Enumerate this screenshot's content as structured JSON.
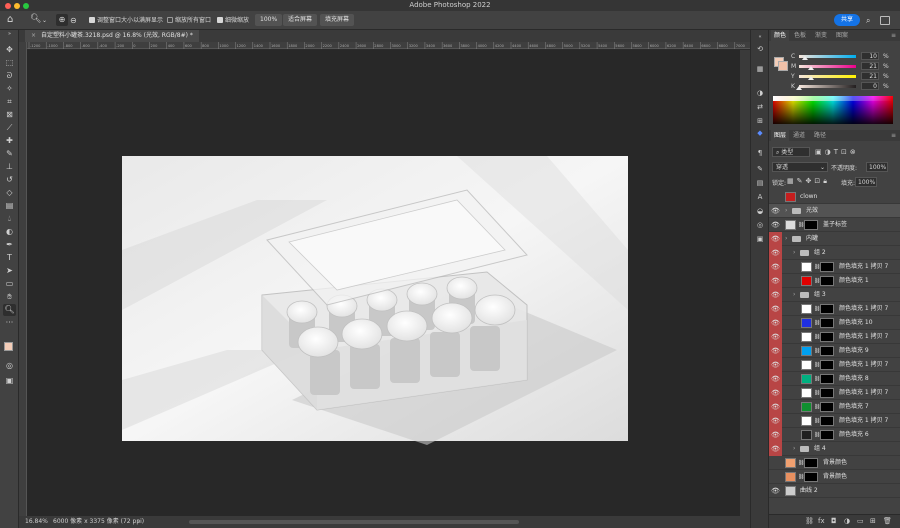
{
  "app": {
    "title": "Adobe Photoshop 2022"
  },
  "options_bar": {
    "resize_windows": "调整窗口大小以满屏显示",
    "zoom_all": "缩放所有窗口",
    "scrubby_zoom": "细微缩放",
    "zoom_value": "100%",
    "fit_screen": "适合屏幕",
    "fill_screen": "填充屏幕",
    "share": "共享"
  },
  "document": {
    "tab": "自定塑料小罐茶.3218.psd @ 16.8% (光效, RGB/8#) *",
    "status_zoom": "16.84%",
    "status_info": "6000 像素 x 3375 像素 (72 ppi)"
  },
  "ruler": {
    "top_ticks": [
      "-1200",
      "-1000",
      "-800",
      "-600",
      "-400",
      "-200",
      "0",
      "200",
      "400",
      "600",
      "800",
      "1000",
      "1200",
      "1400",
      "1600",
      "1800",
      "2000",
      "2200",
      "2400",
      "2600",
      "2800",
      "3000",
      "3200",
      "3400",
      "3600",
      "3800",
      "4000",
      "4200",
      "4400",
      "4600",
      "4800",
      "5000",
      "5200",
      "5400",
      "5600",
      "5800",
      "6000",
      "6200",
      "6400",
      "6600",
      "6800",
      "7000"
    ]
  },
  "color_panel": {
    "tabs": [
      "颜色",
      "色板",
      "渐变",
      "图案"
    ],
    "sliders": [
      {
        "label": "C",
        "value": "10",
        "color": "#00aeef"
      },
      {
        "label": "M",
        "value": "21",
        "color": "#ec008c"
      },
      {
        "label": "Y",
        "value": "21",
        "color": "#fff200"
      },
      {
        "label": "K",
        "value": "0",
        "color": "#231f20"
      }
    ],
    "pct": "%",
    "fg_color": "#f4cdb8",
    "bg_color": "#f0c0a8"
  },
  "layers_panel": {
    "tabs": [
      "图层",
      "通道",
      "路径"
    ],
    "filter": "类型",
    "blend": "穿透",
    "opacity_label": "不透明度:",
    "opacity": "100%",
    "lock_label": "锁定:",
    "fill_label": "填充:",
    "fill": "100%",
    "layers": [
      {
        "name": "clown",
        "indent": 0,
        "kind": "layer",
        "eye": false,
        "thumb": "#c51e1e",
        "mask": false,
        "swatch": "",
        "red": false
      },
      {
        "name": "光效",
        "indent": 0,
        "kind": "group",
        "eye": true,
        "thumb": "",
        "mask": false,
        "swatch": "",
        "red": false,
        "selected": true
      },
      {
        "name": "盖子标签",
        "indent": 0,
        "kind": "layer",
        "eye": true,
        "thumb": "#dcdcdc",
        "mask": true,
        "swatch": "",
        "red": false
      },
      {
        "name": "内罐",
        "indent": 0,
        "kind": "group",
        "eye": true,
        "thumb": "",
        "mask": false,
        "swatch": "",
        "red": true
      },
      {
        "name": "组 2",
        "indent": 1,
        "kind": "group",
        "eye": true,
        "thumb": "",
        "mask": false,
        "swatch": "",
        "red": true
      },
      {
        "name": "颜色填充 1 拷贝 7",
        "indent": 2,
        "kind": "layer",
        "eye": true,
        "thumb": "#ffffff",
        "mask": true,
        "swatch": "",
        "red": true
      },
      {
        "name": "颜色填充 1",
        "indent": 2,
        "kind": "layer",
        "eye": true,
        "thumb": "",
        "mask": true,
        "swatch": "#e00000",
        "red": true
      },
      {
        "name": "组 3",
        "indent": 1,
        "kind": "group",
        "eye": true,
        "thumb": "",
        "mask": false,
        "swatch": "",
        "red": true
      },
      {
        "name": "颜色填充 1 拷贝 7",
        "indent": 2,
        "kind": "layer",
        "eye": true,
        "thumb": "#ffffff",
        "mask": true,
        "swatch": "",
        "red": true
      },
      {
        "name": "颜色填充 10",
        "indent": 2,
        "kind": "layer",
        "eye": true,
        "thumb": "",
        "mask": true,
        "swatch": "#1f2fe0",
        "red": true
      },
      {
        "name": "颜色填充 1 拷贝 7",
        "indent": 2,
        "kind": "layer",
        "eye": true,
        "thumb": "#ffffff",
        "mask": true,
        "swatch": "",
        "red": true
      },
      {
        "name": "颜色填充 9",
        "indent": 2,
        "kind": "layer",
        "eye": true,
        "thumb": "",
        "mask": true,
        "swatch": "#00a0f0",
        "red": true
      },
      {
        "name": "颜色填充 1 拷贝 7",
        "indent": 2,
        "kind": "layer",
        "eye": true,
        "thumb": "#ffffff",
        "mask": true,
        "swatch": "",
        "red": true
      },
      {
        "name": "颜色填充 8",
        "indent": 2,
        "kind": "layer",
        "eye": true,
        "thumb": "",
        "mask": true,
        "swatch": "#00b080",
        "red": true
      },
      {
        "name": "颜色填充 1 拷贝 7",
        "indent": 2,
        "kind": "layer",
        "eye": true,
        "thumb": "#ffffff",
        "mask": true,
        "swatch": "",
        "red": true
      },
      {
        "name": "颜色填充 7",
        "indent": 2,
        "kind": "layer",
        "eye": true,
        "thumb": "",
        "mask": true,
        "swatch": "#109030",
        "red": true
      },
      {
        "name": "颜色填充 1 拷贝 7",
        "indent": 2,
        "kind": "layer",
        "eye": true,
        "thumb": "#ffffff",
        "mask": true,
        "swatch": "",
        "red": true
      },
      {
        "name": "颜色填充 6",
        "indent": 2,
        "kind": "layer",
        "eye": true,
        "thumb": "",
        "mask": true,
        "swatch": "#202020",
        "red": true
      },
      {
        "name": "组 4",
        "indent": 1,
        "kind": "group",
        "eye": true,
        "thumb": "",
        "mask": false,
        "swatch": "",
        "red": true
      },
      {
        "name": "背景颜色",
        "indent": 0,
        "kind": "layer",
        "eye": false,
        "thumb": "",
        "mask": true,
        "swatch": "#f0a070",
        "red": false
      },
      {
        "name": "背景颜色",
        "indent": 0,
        "kind": "layer",
        "eye": false,
        "thumb": "",
        "mask": true,
        "swatch": "#e89060",
        "red": false
      },
      {
        "name": "曲线 2",
        "indent": 0,
        "kind": "layer",
        "eye": true,
        "thumb": "#cccccc",
        "mask": false,
        "swatch": "",
        "red": false
      }
    ],
    "bottom_icons": [
      "link-icon",
      "fx-icon",
      "mask-icon",
      "adjustment-icon",
      "group-icon",
      "new-layer-icon",
      "trash-icon"
    ]
  }
}
